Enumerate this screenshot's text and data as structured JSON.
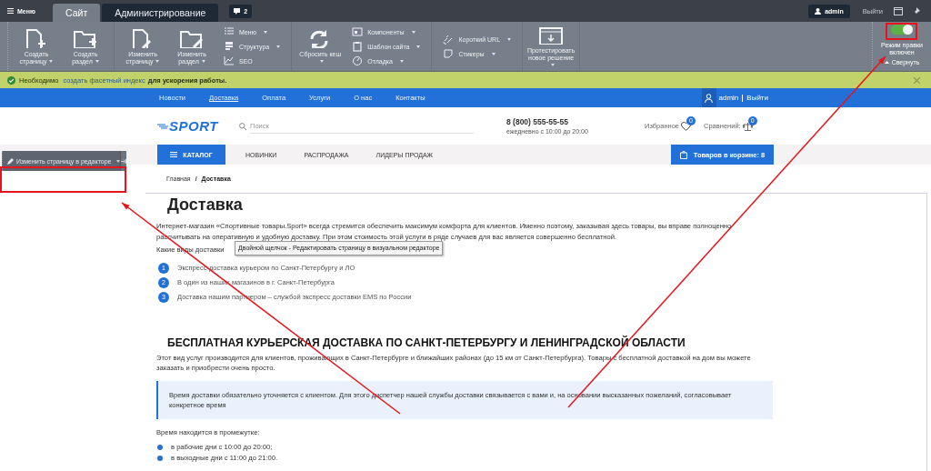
{
  "admin_bar": {
    "menu": "Меню",
    "tabs": [
      {
        "label": "Сайт",
        "selected": true
      },
      {
        "label": "Администрирование",
        "selected": false
      }
    ],
    "notifications": "2",
    "user": "admin",
    "logout": "Выйти"
  },
  "toolbar": {
    "groups": [
      {
        "items": [
          {
            "kind": "large",
            "label": "Создать страницу",
            "dropdown": true
          },
          {
            "kind": "large",
            "label": "Создать раздел",
            "dropdown": true
          }
        ]
      },
      {
        "items": [
          {
            "kind": "large",
            "label": "Изменить страницу",
            "dropdown": true
          },
          {
            "kind": "large",
            "label": "Изменить раздел",
            "dropdown": true
          },
          {
            "kind": "list",
            "entries": [
              {
                "label": "Меню",
                "dropdown": true
              },
              {
                "label": "Структура",
                "dropdown": true
              },
              {
                "label": "SEO",
                "dropdown": false
              }
            ]
          }
        ]
      },
      {
        "items": [
          {
            "kind": "large",
            "label": "Сбросить кеш",
            "dropdown": true
          },
          {
            "kind": "list",
            "entries": [
              {
                "label": "Компоненты",
                "dropdown": true
              },
              {
                "label": "Шаблон сайта",
                "dropdown": true
              },
              {
                "label": "Отладка",
                "dropdown": true
              }
            ]
          }
        ]
      },
      {
        "items": [
          {
            "kind": "list",
            "entries": [
              {
                "label": "Короткий URL",
                "dropdown": true
              },
              {
                "label": "Стикеры",
                "dropdown": true
              }
            ]
          }
        ]
      },
      {
        "items": [
          {
            "kind": "large",
            "label": "Протестировать новое решение",
            "dropdown": true
          }
        ]
      }
    ],
    "edit_mode": {
      "on": true,
      "label": "Режим правки включен"
    },
    "collapse": "Свернуть"
  },
  "notice": {
    "before": "Необходимо",
    "link": "создать фасетный индекс",
    "after": "для ускорения работы."
  },
  "site_nav": {
    "items": [
      {
        "label": "Новости",
        "selected": false
      },
      {
        "label": "Доставка",
        "selected": true
      },
      {
        "label": "Оплата",
        "selected": false
      },
      {
        "label": "Услуги",
        "selected": false
      },
      {
        "label": "О нас",
        "selected": false
      },
      {
        "label": "Контакты",
        "selected": false
      }
    ],
    "user": "admin",
    "logout": "Выйти"
  },
  "header": {
    "logo": "SPORT",
    "search": {
      "placeholder": "Поиск"
    },
    "phone": "8 (800) 555-55-55",
    "hours": "ежедневно с 10:00 до 20:00",
    "favorites": {
      "label": "Избранное",
      "count": "0"
    },
    "compare": {
      "label": "Сравнений:",
      "count": "0"
    }
  },
  "categories": {
    "catalog": "КАТАЛОГ",
    "items": [
      "НОВИНКИ",
      "РАСПРОДАЖА",
      "ЛИДЕРЫ ПРОДАЖ"
    ],
    "cart": "Товаров в корзине: 8"
  },
  "edit_panel": {
    "label": "Изменить страницу в редакторе"
  },
  "breadcrumb": {
    "items": [
      "Главная",
      "Доставка"
    ],
    "separator": "/"
  },
  "content": {
    "title": "Доставка",
    "intro": "Интернет-магазин «Спортивные товары.Sport» всегда стремится обеспечить максимум комфорта для клиентов. Именно поэтому, заказывая здесь товары, вы вправе полноценно рассчитывать на оперативную и удобную доставку. При этом стоимость этой услуги в ряде случаев для вас является совершенно бесплатной.",
    "question": "Какие виды доставки",
    "tooltip": "Двойной щелчок - Редактировать страницу в визуальном редакторе",
    "steps": [
      {
        "number": "1",
        "text": "Экспресс-доставка курьером по Санкт-Петербургу и ЛО"
      },
      {
        "number": "2",
        "text": "В один из наших магазинов в г. Санкт-Петербурга"
      },
      {
        "number": "3",
        "text": "Доставка нашим партнером – службой экспресс доставки EMS по России"
      }
    ],
    "section_title": "БЕСПЛАТНАЯ КУРЬЕРСКАЯ ДОСТАВКА ПО САНКТ-ПЕТЕРБУРГУ И ЛЕНИНГРАДСКОЙ ОБЛАСТИ",
    "section_text": "Этот вид услуг производится для клиентов, проживающих в Санкт-Петербурге и ближайших районах (до 15 км от Санкт-Петербурга). Товары с бесплатной доставкой на дом вы можете заказать и приобрести очень просто.",
    "callout": "Время доставки обязательно уточняется с клиентом. Для этого диспетчер нашей службы доставки связывается с вами и, на основании высказанных пожеланий, согласовывает конкретное время",
    "time_intro": "Время находится в промежутке:",
    "times": [
      "в рабочие дни с 10:00 до 20:00;",
      "в выходные дни с 11:00 до 21:00."
    ]
  }
}
